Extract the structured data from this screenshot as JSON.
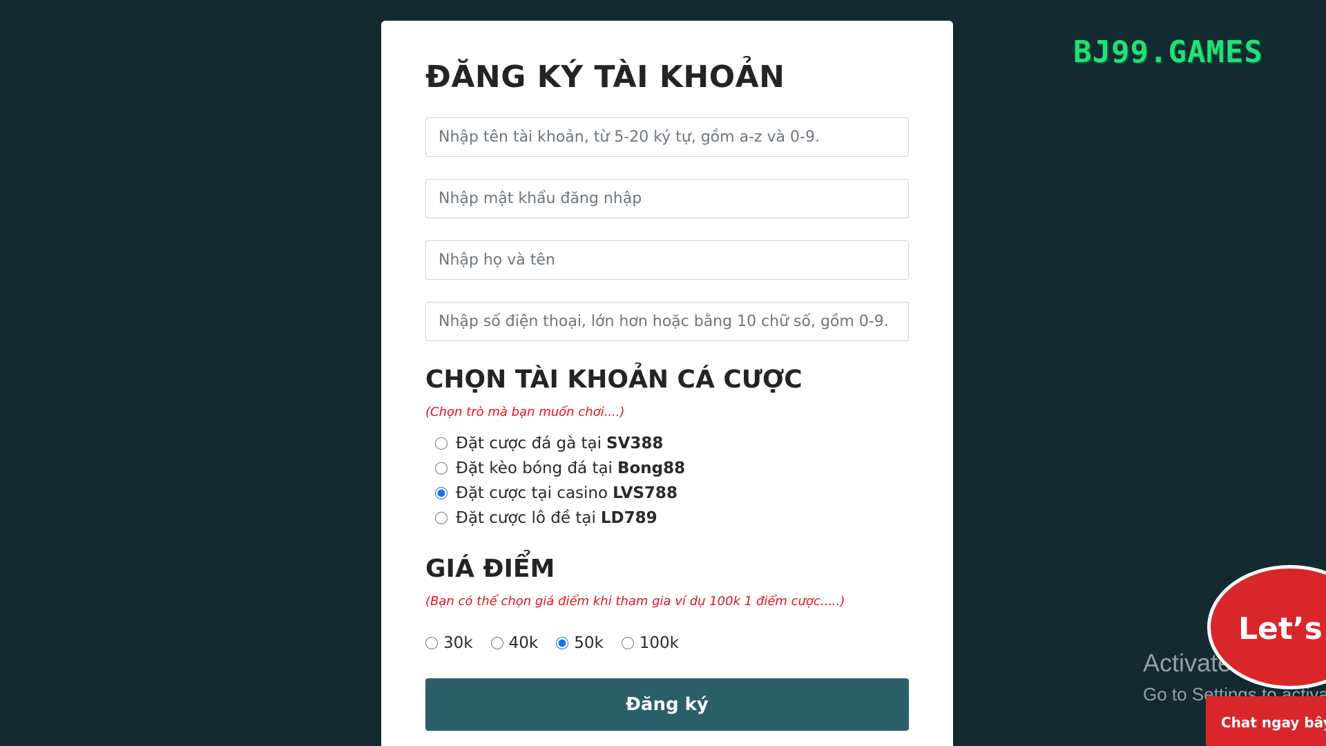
{
  "form": {
    "title": "ĐĂNG KÝ TÀI KHOẢN",
    "username_placeholder": "Nhập tên tài khoản, từ 5-20 ký tự, gồm a-z và 0-9.",
    "password_placeholder": "Nhập mật khẩu đăng nhập",
    "fullname_placeholder": "Nhập họ và tên",
    "phone_placeholder": "Nhập số điện thoại, lớn hơn hoặc bằng 10 chữ số, gồm 0-9.",
    "account_section": {
      "title": "CHỌN TÀI KHOẢN CÁ CƯỢC",
      "hint": "(Chọn trò mà bạn muốn chơi....)",
      "options": [
        {
          "text": "Đặt cược đá gà tại",
          "brand": "SV388",
          "checked": false
        },
        {
          "text": "Đặt kèo bóng đá tại",
          "brand": "Bong88",
          "checked": false
        },
        {
          "text": "Đặt cược tại casino",
          "brand": "LVS788",
          "checked": true
        },
        {
          "text": "Đặt cược lô đề tại",
          "brand": "LD789",
          "checked": false
        }
      ]
    },
    "price_section": {
      "title": "GIÁ ĐIỂM",
      "hint": "(Bạn có thể chọn giá điểm khi tham gia ví dụ 100k 1 điểm cược.....)",
      "options": [
        {
          "label": "30k",
          "checked": false
        },
        {
          "label": "40k",
          "checked": false
        },
        {
          "label": "50k",
          "checked": true
        },
        {
          "label": "100k",
          "checked": false
        }
      ]
    },
    "submit_label": "Đăng ký"
  },
  "brand": {
    "logo_text": "BJ99.GAMES",
    "color": "#22e07a"
  },
  "chat_widget": {
    "bubble_text": "Let’s t",
    "tab_text": "Chat ngay bây g",
    "color": "#d9262b"
  },
  "watermark": {
    "line1": "Activate Windows",
    "line2": "Go to Settings to activate Windows."
  },
  "colors": {
    "background": "#132a30",
    "button": "#2a5f6a",
    "hint": "#e8121c"
  }
}
